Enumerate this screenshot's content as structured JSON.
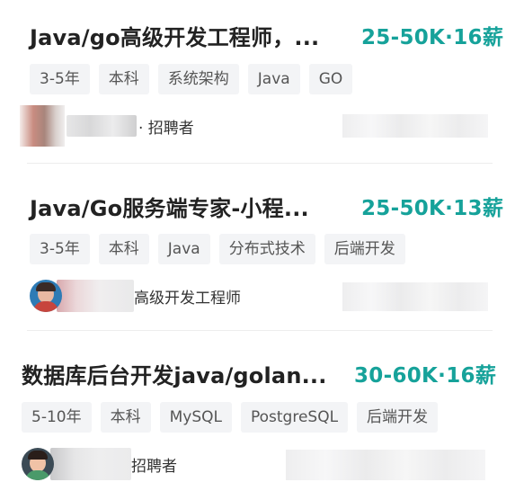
{
  "jobs": [
    {
      "title": "Java/go高级开发工程师，...",
      "salary": "25-50K·16薪",
      "tags": [
        "3-5年",
        "本科",
        "系统架构",
        "Java",
        "GO"
      ],
      "recruiter_title": "· 招聘者"
    },
    {
      "title": "Java/Go服务端专家-小程...",
      "salary": "25-50K·13薪",
      "tags": [
        "3-5年",
        "本科",
        "Java",
        "分布式技术",
        "后端开发"
      ],
      "recruiter_title": "高级开发工程师"
    },
    {
      "title": "数据库后台开发java/golan...",
      "salary": "30-60K·16薪",
      "tags": [
        "5-10年",
        "本科",
        "MySQL",
        "PostgreSQL",
        "后端开发"
      ],
      "recruiter_title": "招聘者"
    }
  ],
  "colors": {
    "salary": "#16a29a",
    "tag_bg": "#f3f4f6",
    "title": "#222222"
  }
}
